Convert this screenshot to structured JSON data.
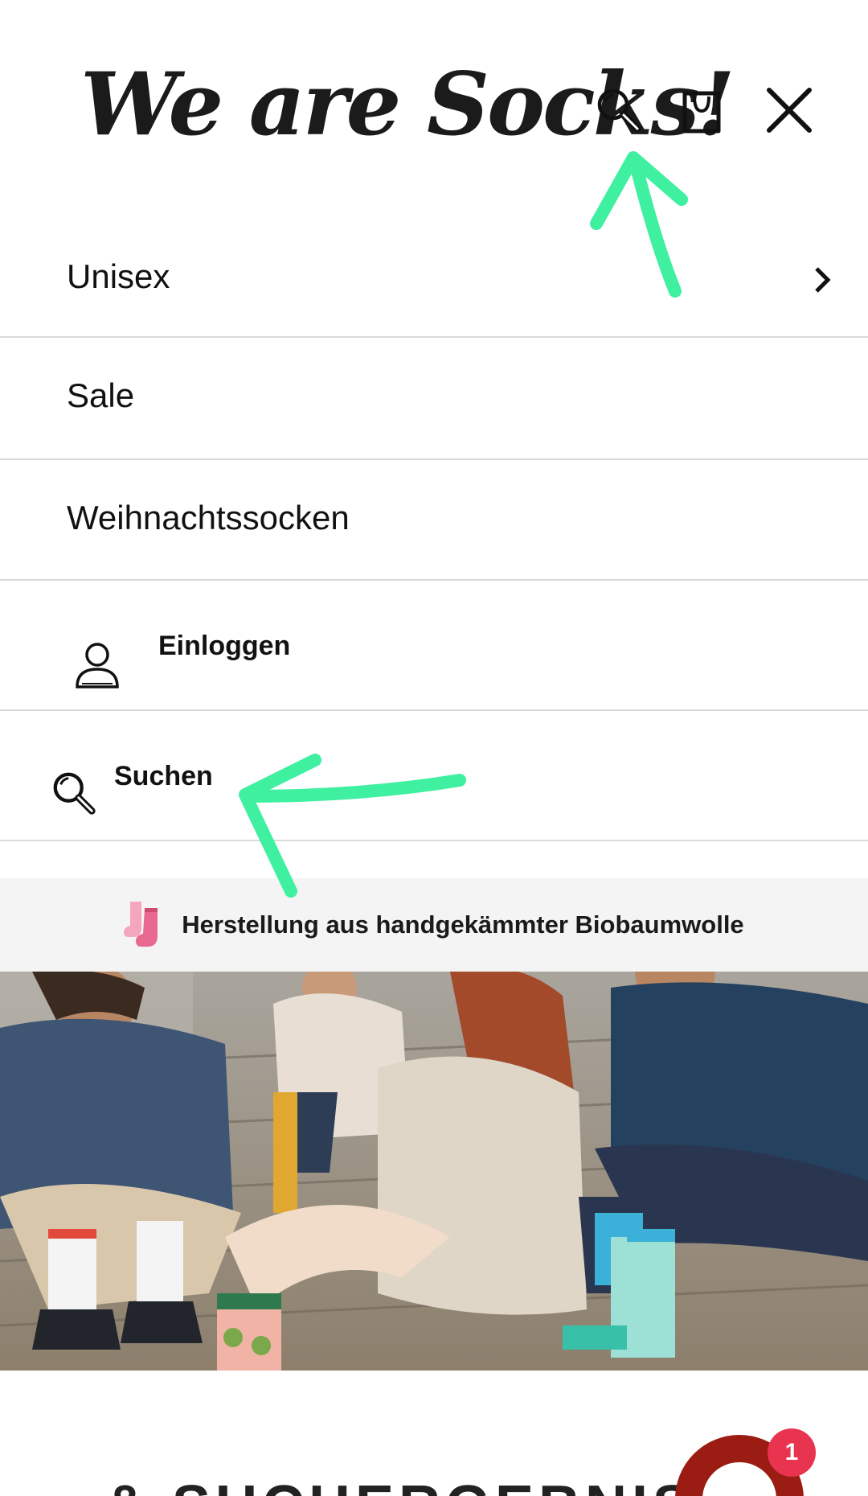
{
  "header": {
    "logo_text": "We are Socks!",
    "icons": [
      "search-icon",
      "shopping-bag-icon",
      "close-icon"
    ]
  },
  "menu": {
    "items": [
      {
        "label": "Unisex",
        "has_submenu": true
      },
      {
        "label": "Sale"
      },
      {
        "label": "Weihnachtssocken"
      }
    ]
  },
  "utility": {
    "login_label": "Einloggen",
    "search_label": "Suchen"
  },
  "banner": {
    "text": "Herstellung aus handgekämmter Biobaumwolle",
    "icon": "socks-icon"
  },
  "bottom": {
    "title_partial": "& SUCHERGEBNIS",
    "badge_count": "1"
  },
  "annotation_color": "#3ef0a0"
}
